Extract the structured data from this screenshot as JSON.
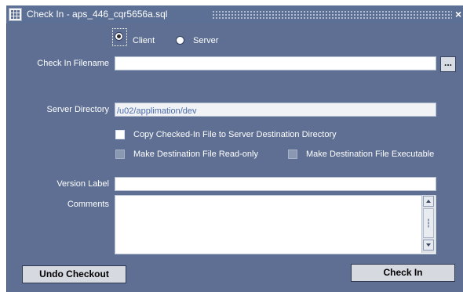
{
  "window": {
    "title": "Check In - aps_446_cqr5656a.sql",
    "close_label": "×"
  },
  "source": {
    "client_label": "Client",
    "server_label": "Server",
    "selected": "Client"
  },
  "check_in_filename": {
    "label": "Check In Filename",
    "value": "",
    "browse_label": "..."
  },
  "server_directory": {
    "label": "Server Directory",
    "value": "/u02/applimation/dev"
  },
  "options": {
    "copy_checked_in": {
      "label": "Copy Checked-In File to Server Destination Directory",
      "checked": false,
      "enabled": true
    },
    "read_only": {
      "label": "Make Destination File Read-only",
      "checked": false,
      "enabled": false
    },
    "executable": {
      "label": "Make Destination File Executable",
      "checked": false,
      "enabled": false
    }
  },
  "version_label": {
    "label": "Version Label",
    "value": ""
  },
  "comments": {
    "label": "Comments",
    "value": ""
  },
  "buttons": {
    "undo_checkout": "Undo Checkout",
    "check_in": "Check In"
  },
  "colors": {
    "titlebar": "#5c6f95",
    "panel": "#5e6f93",
    "button": "#d6d9df"
  }
}
